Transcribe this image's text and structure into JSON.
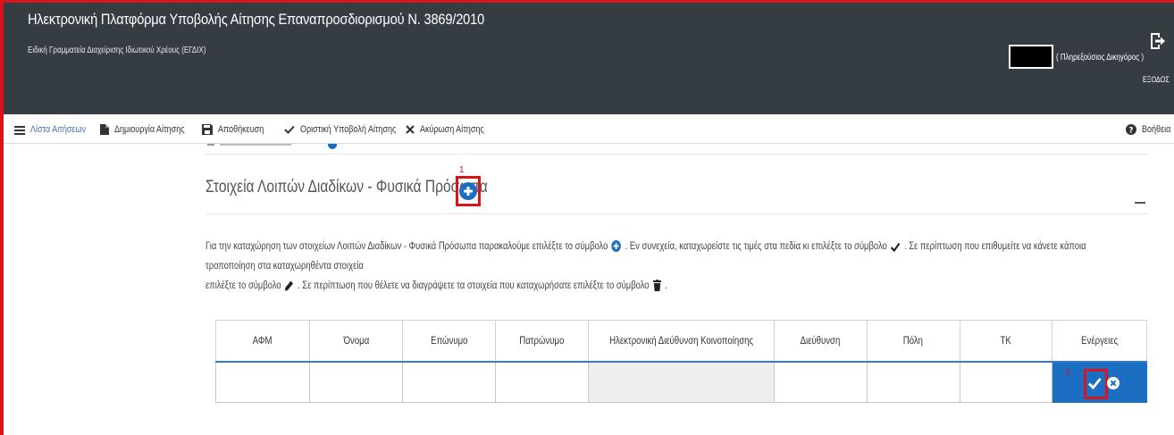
{
  "header": {
    "title": "Ηλεκτρονική Πλατφόρμα Υποβολής Αίτησης Επαναπροσδιορισμού Ν. 3869/2010",
    "subtitle": "Ειδική Γραμματεία Διαχείρισης Ιδιωτικού Χρέους (ΕΓΔΙΧ)",
    "user_role": "( Πληρεξούσιος Δικηγόρος )",
    "exit_label": "ΕΞΟΔΟΣ",
    "exit_icon": "sign-out-icon"
  },
  "toolbar": {
    "items": [
      {
        "label": "Λίστα Αιτήσεων",
        "icon": "list-icon"
      },
      {
        "label": "Δημιουργία Αίτησης",
        "icon": "file-icon"
      },
      {
        "label": "Αποθήκευση",
        "icon": "save-icon"
      },
      {
        "label": "Οριστική Υποβολή Αίτησης",
        "icon": "check-icon"
      },
      {
        "label": "Ακύρωση Αίτησης",
        "icon": "times-icon"
      }
    ],
    "help_label": "Βοήθεια"
  },
  "section": {
    "title": "Στοιχεία Λοιπών Διαδίκων - Φυσικά Πρόσωπα",
    "marker_1": "1",
    "instructions": {
      "part1": "Για την καταχώρηση των στοιχείων Λοιπών Διαδίκων - Φυσικά Πρόσωπα παρακαλούμε επιλέξτε το σύμβολο",
      "part2": ". Εν συνεχεία, καταχωρείστε τις τιμές στα πεδία κι επιλέξτε το σύμβολο",
      "part3": ". Σε περίπτωση που επιθυμείτε να κάνετε κάποια τροποποίηση στα καταχωρηθέντα στοιχεία",
      "part4": "επιλέξτε το σύμβολο",
      "part5": ". Σε περίπτωση που θέλετε να διαγράψετε τα στοιχεία που καταχωρήσατε επιλέξτε το σύμβολο",
      "part6": "."
    }
  },
  "table": {
    "columns": [
      "ΑΦΜ",
      "Όνομα",
      "Επώνυμο",
      "Πατρώνυμο",
      "Ηλεκτρονική Διεύθυνση Κοινοποίησης",
      "Διεύθυνση",
      "Πόλη",
      "ΤΚ",
      "Ενέργειες"
    ],
    "row": {
      "afm": "",
      "onoma": "",
      "eponymo": "",
      "patronymo": "",
      "email": "",
      "address": "",
      "city": "",
      "tk": ""
    },
    "marker_2": "2"
  },
  "colors": {
    "header_bg": "#353d43",
    "highlight_red": "#d9141b",
    "accent_blue": "#1b6ec2",
    "table_header_line": "#3a78c3"
  }
}
